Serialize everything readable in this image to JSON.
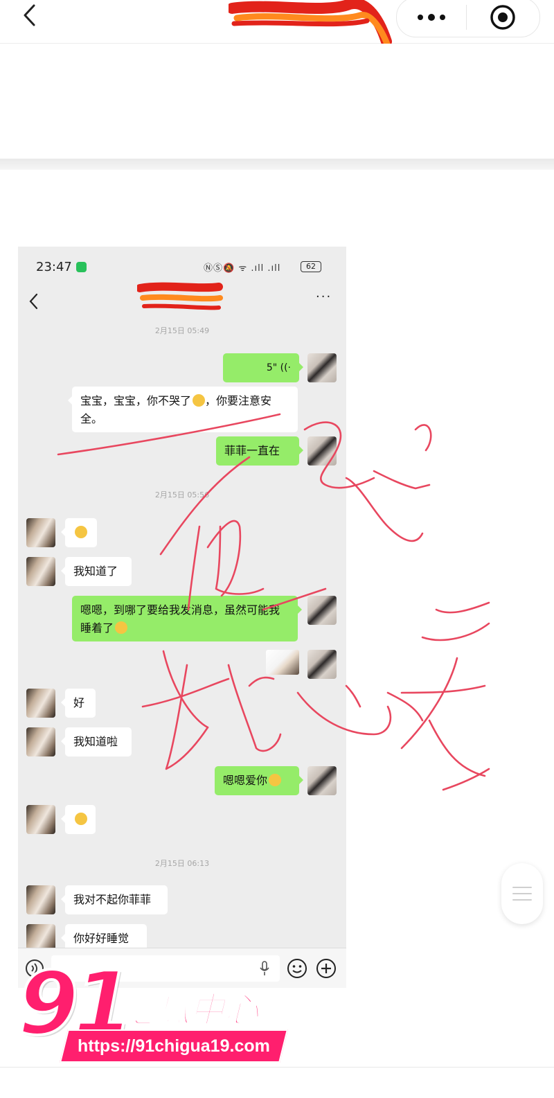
{
  "outer_header": {
    "back_icon": "chevron-left-icon",
    "more_icon": "more-dots-icon",
    "close_icon": "target-circle-icon"
  },
  "chat_screenshot": {
    "status_bar": {
      "time": "23:47",
      "indicators": "ⓃⓈ🔕 ᯤ .ıll .ıll",
      "battery": "62"
    },
    "header": {
      "back_icon": "chevron-left-icon",
      "more": "···"
    },
    "timestamps": [
      "2月15日 05:49",
      "2月15日 05:56",
      "2月15日 06:13"
    ],
    "messages": [
      {
        "side": "me",
        "text": "5\" ((·"
      },
      {
        "side": "her",
        "text": "宝宝，宝宝，你不哭了",
        "text_after": "，你要注意安全。"
      },
      {
        "side": "me",
        "text": "菲菲一直在"
      },
      {
        "side": "her",
        "text": ""
      },
      {
        "side": "her",
        "text": "我知道了"
      },
      {
        "side": "me",
        "text": "嗯嗯，到哪了要给我发消息，虽然可能我睡着了"
      },
      {
        "side": "me",
        "text": ""
      },
      {
        "side": "her",
        "text": "好"
      },
      {
        "side": "her",
        "text": "我知道啦"
      },
      {
        "side": "me",
        "text": "嗯嗯爱你"
      },
      {
        "side": "her",
        "text": ""
      },
      {
        "side": "her",
        "text": "我对不起你菲菲"
      },
      {
        "side": "her",
        "text": "你好好睡觉"
      }
    ],
    "input_bar": {
      "voice_icon": "voice-icon",
      "mic_icon": "mic-icon",
      "emoji_icon": "emoji-icon",
      "plus_icon": "plus-icon"
    }
  },
  "handwriting": {
    "words": "他是 我心疼",
    "color": "#e8475f"
  },
  "watermark": {
    "number": "91",
    "brand": "吃瓜中心",
    "url": "https://91chigua19.com",
    "color": "#ff1f6e"
  },
  "colors": {
    "chat_bg": "#ededed",
    "bubble_green": "#95ec69",
    "bubble_white": "#ffffff",
    "scribble_red": "#e2231a",
    "scribble_orange": "#ff8a1e"
  }
}
